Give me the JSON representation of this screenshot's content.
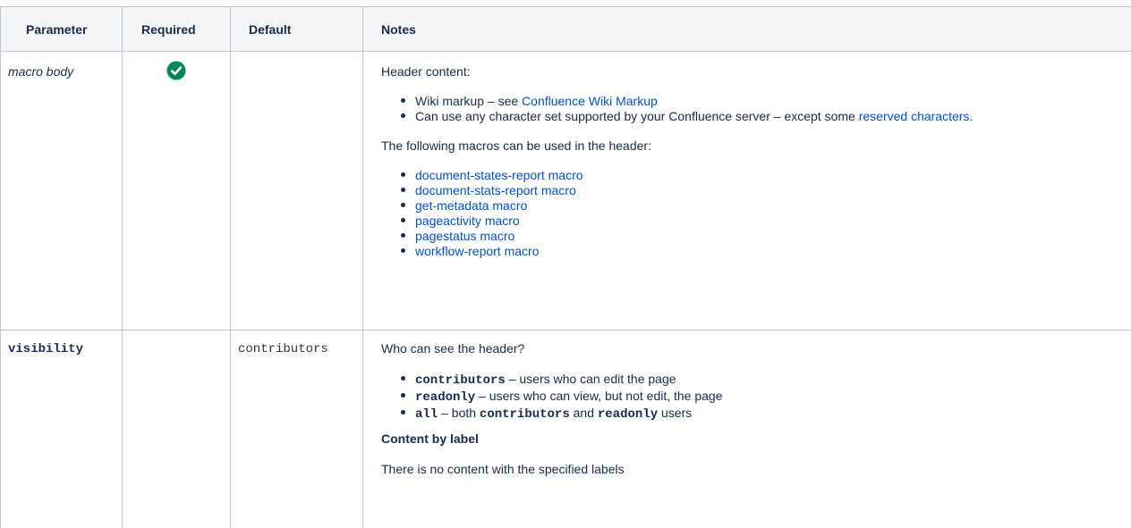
{
  "table": {
    "headers": [
      "Parameter",
      "Required",
      "Default",
      "Notes"
    ],
    "rows": [
      {
        "parameter": "macro body",
        "required": "check-circle-icon",
        "default": "",
        "notes": {
          "intro": "Header content:",
          "bullets": [
            {
              "before": "Wiki markup – see ",
              "link": "Confluence Wiki Markup",
              "after": ""
            },
            {
              "before": "Can use any character set supported by your Confluence server – except some ",
              "link": "reserved characters",
              "after": "."
            }
          ],
          "macros_intro": "The following macros can be used in the header:",
          "macros": [
            "document-states-report macro",
            "document-stats-report macro",
            "get-metadata macro",
            "pageactivity macro",
            "pagestatus macro",
            "workflow-report macro"
          ]
        }
      },
      {
        "parameter": "visibility",
        "required": "",
        "default": "contributors",
        "notes": {
          "intro": "Who can see the header?",
          "options": [
            {
              "code": "contributors",
              "text": " – users who can edit the page"
            },
            {
              "code": "readonly",
              "text": " – users who can view, but not edit, the page"
            }
          ],
          "all_option": {
            "code": "all",
            "t1": " – both ",
            "code2": "contributors",
            "t2": " and ",
            "code3": "readonly",
            "t3": " users"
          },
          "content_heading": "Content by label",
          "content_message": "There is no content with the specified labels"
        }
      }
    ]
  },
  "colors": {
    "border": "#c1c7d0",
    "header_bg": "#f4f5f7",
    "link": "#0052cc",
    "check": "#00875a"
  }
}
